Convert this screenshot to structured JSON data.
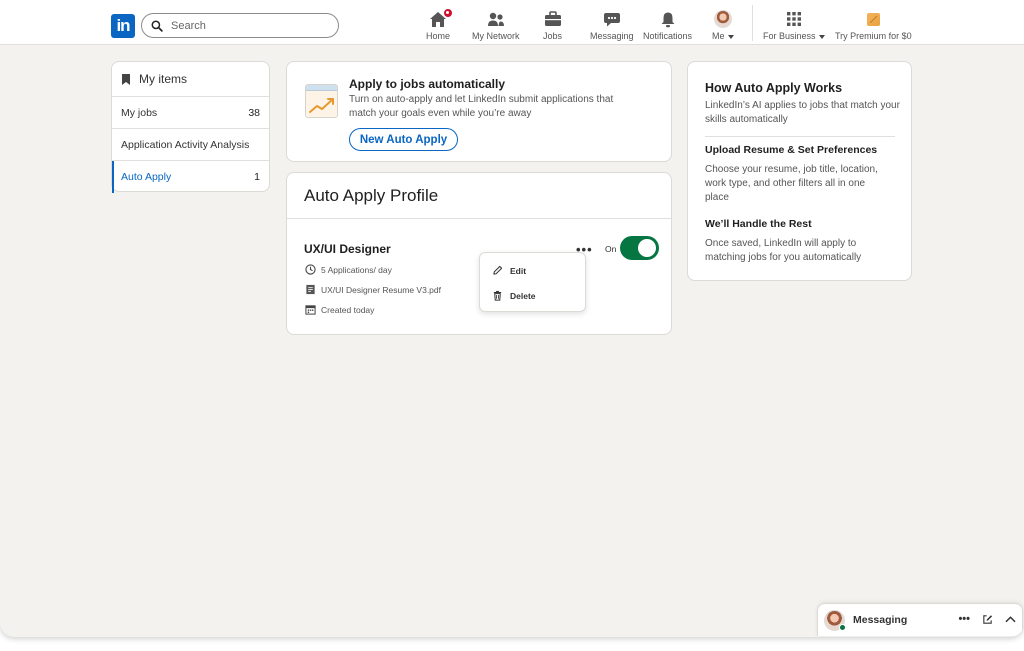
{
  "nav": {
    "logo_text": "in",
    "search_placeholder": "Search",
    "items": [
      {
        "label": "Home",
        "icon": "home-icon"
      },
      {
        "label": "My Network",
        "icon": "network-icon"
      },
      {
        "label": "Jobs",
        "icon": "jobs-icon"
      },
      {
        "label": "Messaging",
        "icon": "messaging-icon"
      },
      {
        "label": "Notifications",
        "icon": "bell-icon"
      },
      {
        "label": "Me",
        "icon": "avatar"
      },
      {
        "label": "For Business",
        "icon": "grid-icon"
      },
      {
        "label": "Try Premium for $0",
        "icon": "premium-icon"
      }
    ]
  },
  "sidebar": {
    "title": "My items",
    "items": [
      {
        "label": "My jobs",
        "count": "38"
      },
      {
        "label": "Application Activity Analysis",
        "count": ""
      },
      {
        "label": "Auto Apply",
        "count": "1"
      }
    ]
  },
  "promo": {
    "title": "Apply to jobs automatically",
    "description": "Turn on auto-apply and let LinkedIn submit applications that match your goals even while you’re away",
    "button": "New Auto Apply"
  },
  "profile_card": {
    "header": "Auto Apply Profile",
    "profile": {
      "title": "UX/UI Designer",
      "rate": "5 Applications/ day",
      "resume": "UX/UI Designer Resume V3.pdf",
      "created": "Created today",
      "more": "•••",
      "toggle_label": "On"
    },
    "menu": {
      "edit": "Edit",
      "delete": "Delete"
    }
  },
  "how_it_works": {
    "title": "How Auto Apply Works",
    "intro": "LinkedIn’s AI applies to jobs that match your skills automatically",
    "step1_title": "Upload Resume & Set Preferences",
    "step1_text": "Choose your resume, job title, location, work type, and other filters all in one place",
    "step2_title": "We’ll Handle the Rest",
    "step2_text": "Once saved, LinkedIn will apply to matching jobs for you automatically"
  },
  "messaging": {
    "label": "Messaging",
    "more": "•••"
  },
  "colors": {
    "brand": "#0a66c2",
    "toggle_on": "#057642",
    "notification_badge": "#cb112d",
    "background": "#f3f2ef"
  }
}
